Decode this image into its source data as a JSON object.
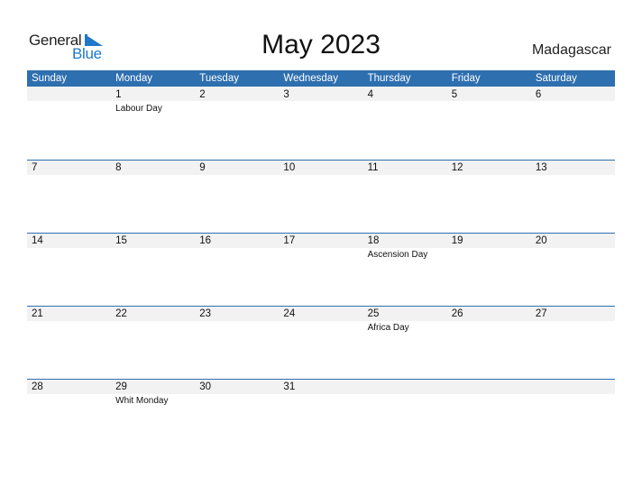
{
  "logo": {
    "word1": "General",
    "word2": "Blue",
    "accent_color": "#1f78c8"
  },
  "title": "May 2023",
  "country": "Madagascar",
  "header_color": "#2e6fb0",
  "weekdays": [
    "Sunday",
    "Monday",
    "Tuesday",
    "Wednesday",
    "Thursday",
    "Friday",
    "Saturday"
  ],
  "weeks": [
    {
      "days": [
        {
          "num": "",
          "holiday": ""
        },
        {
          "num": "1",
          "holiday": "Labour Day"
        },
        {
          "num": "2",
          "holiday": ""
        },
        {
          "num": "3",
          "holiday": ""
        },
        {
          "num": "4",
          "holiday": ""
        },
        {
          "num": "5",
          "holiday": ""
        },
        {
          "num": "6",
          "holiday": ""
        }
      ]
    },
    {
      "days": [
        {
          "num": "7",
          "holiday": ""
        },
        {
          "num": "8",
          "holiday": ""
        },
        {
          "num": "9",
          "holiday": ""
        },
        {
          "num": "10",
          "holiday": ""
        },
        {
          "num": "11",
          "holiday": ""
        },
        {
          "num": "12",
          "holiday": ""
        },
        {
          "num": "13",
          "holiday": ""
        }
      ]
    },
    {
      "days": [
        {
          "num": "14",
          "holiday": ""
        },
        {
          "num": "15",
          "holiday": ""
        },
        {
          "num": "16",
          "holiday": ""
        },
        {
          "num": "17",
          "holiday": ""
        },
        {
          "num": "18",
          "holiday": "Ascension Day"
        },
        {
          "num": "19",
          "holiday": ""
        },
        {
          "num": "20",
          "holiday": ""
        }
      ]
    },
    {
      "days": [
        {
          "num": "21",
          "holiday": ""
        },
        {
          "num": "22",
          "holiday": ""
        },
        {
          "num": "23",
          "holiday": ""
        },
        {
          "num": "24",
          "holiday": ""
        },
        {
          "num": "25",
          "holiday": "Africa Day"
        },
        {
          "num": "26",
          "holiday": ""
        },
        {
          "num": "27",
          "holiday": ""
        }
      ]
    },
    {
      "days": [
        {
          "num": "28",
          "holiday": ""
        },
        {
          "num": "29",
          "holiday": "Whit Monday"
        },
        {
          "num": "30",
          "holiday": ""
        },
        {
          "num": "31",
          "holiday": ""
        },
        {
          "num": "",
          "holiday": ""
        },
        {
          "num": "",
          "holiday": ""
        },
        {
          "num": "",
          "holiday": ""
        }
      ]
    }
  ]
}
